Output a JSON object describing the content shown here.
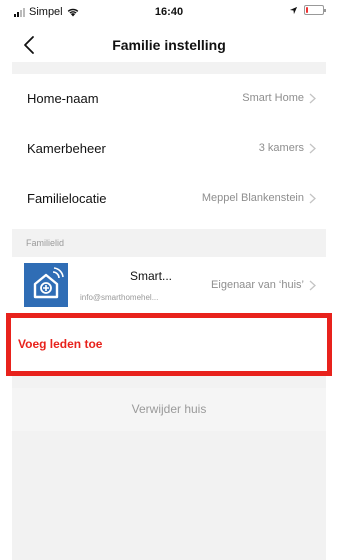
{
  "status_bar": {
    "carrier": "Simpel",
    "time": "16:40",
    "battery_percent": 15
  },
  "nav": {
    "title": "Familie instelling"
  },
  "rows": {
    "home_name": {
      "label": "Home-naam",
      "value": "Smart Home"
    },
    "room_management": {
      "label": "Kamerbeheer",
      "value": "3 kamers"
    },
    "family_location": {
      "label": "Familielocatie",
      "value": "Meppel Blankenstein"
    }
  },
  "members_section": {
    "header": "Familielid",
    "members": [
      {
        "name": "Smart...",
        "email": "info@smarthomehel...",
        "role": "Eigenaar van ‘huis’",
        "avatar_icon": "smart-home-app-icon"
      }
    ]
  },
  "actions": {
    "add_members": "Voeg leden toe",
    "delete_home": "Verwijder huis"
  },
  "colors": {
    "accent_red": "#e8221c",
    "avatar_blue": "#2f6db5",
    "secondary_text": "#8e8e8e",
    "section_background": "#f2f2f2"
  }
}
